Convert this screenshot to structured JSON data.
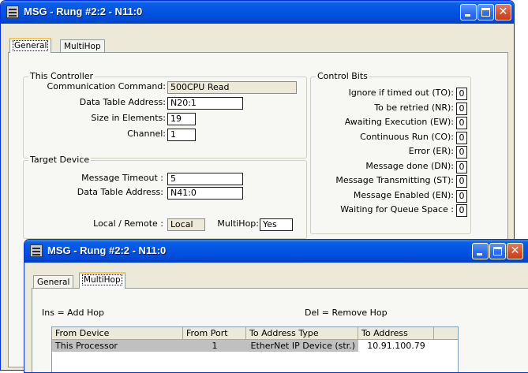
{
  "back_window": {
    "title": "MSG - Rung #2:2 - N11:0",
    "tabs": [
      "General",
      "MultiHop"
    ],
    "this_controller": {
      "title": "This Controller",
      "fields": [
        {
          "label": "Communication Command:",
          "value": "500CPU Read"
        },
        {
          "label": "Data Table Address:",
          "value": "N20:1"
        },
        {
          "label": "Size in Elements:",
          "value": "19"
        },
        {
          "label": "Channel:",
          "value": "1"
        }
      ]
    },
    "target_device": {
      "title": "Target Device",
      "message_timeout": {
        "label": "Message Timeout :",
        "value": "5"
      },
      "data_table_address": {
        "label": "Data Table Address:",
        "value": "N41:0"
      },
      "local_remote": {
        "label": "Local / Remote :",
        "value": "Local"
      },
      "multihop": {
        "label": "MultiHop:",
        "value": "Yes"
      }
    },
    "control_bits": {
      "title": "Control Bits",
      "bits": [
        {
          "label": "Ignore if timed out (TO):",
          "value": "0"
        },
        {
          "label": "To be retried (NR):",
          "value": "0"
        },
        {
          "label": "Awaiting Execution (EW):",
          "value": "0"
        },
        {
          "label": "Continuous Run (CO):",
          "value": "0"
        },
        {
          "label": "Error (ER):",
          "value": "0"
        },
        {
          "label": "Message done (DN):",
          "value": "0"
        },
        {
          "label": "Message Transmitting (ST):",
          "value": "0"
        },
        {
          "label": "Message Enabled (EN):",
          "value": "0"
        },
        {
          "label": "Waiting for Queue Space :",
          "value": "0"
        }
      ]
    }
  },
  "front_window": {
    "title": "MSG - Rung #2:2 - N11:0",
    "tabs": [
      "General",
      "MultiHop"
    ],
    "ins_hint": "Ins = Add Hop",
    "del_hint": "Del = Remove Hop",
    "columns": [
      "From Device",
      "From Port",
      "To Address Type",
      "To Address"
    ],
    "rows": [
      [
        "This Processor",
        "1",
        "EtherNet IP Device (str.)",
        "10.91.100.79"
      ]
    ]
  },
  "colors": {
    "title_bar": "#0054e3",
    "window_face": "#ece9d8",
    "tab_highlight": "#ffc83c"
  }
}
